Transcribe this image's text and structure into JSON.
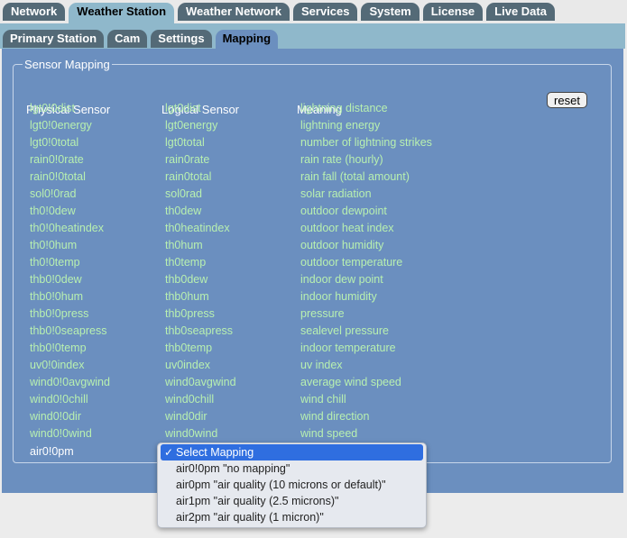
{
  "main_tabs": [
    "Network",
    "Weather Station",
    "Weather Network",
    "Services",
    "System",
    "License",
    "Live Data"
  ],
  "main_active": "Weather Station",
  "sub_tabs": [
    "Primary Station",
    "Cam",
    "Settings",
    "Mapping"
  ],
  "sub_active": "Mapping",
  "section": {
    "legend": "Sensor Mapping",
    "col_physical": "Physical Sensor",
    "col_logical": "Logical Sensor",
    "col_meaning": "Meaning",
    "reset_label": "reset"
  },
  "rows": [
    {
      "physical": "lgt0!0dist",
      "logical": "lgt0dist",
      "meaning": "lightning distance"
    },
    {
      "physical": "lgt0!0energy",
      "logical": "lgt0energy",
      "meaning": "lightning energy"
    },
    {
      "physical": "lgt0!0total",
      "logical": "lgt0total",
      "meaning": "number of lightning strikes"
    },
    {
      "physical": "rain0!0rate",
      "logical": "rain0rate",
      "meaning": "rain rate (hourly)"
    },
    {
      "physical": "rain0!0total",
      "logical": "rain0total",
      "meaning": "rain fall (total amount)"
    },
    {
      "physical": "sol0!0rad",
      "logical": "sol0rad",
      "meaning": "solar radiation"
    },
    {
      "physical": "th0!0dew",
      "logical": "th0dew",
      "meaning": "outdoor dewpoint"
    },
    {
      "physical": "th0!0heatindex",
      "logical": "th0heatindex",
      "meaning": "outdoor heat index"
    },
    {
      "physical": "th0!0hum",
      "logical": "th0hum",
      "meaning": "outdoor humidity"
    },
    {
      "physical": "th0!0temp",
      "logical": "th0temp",
      "meaning": "outdoor temperature"
    },
    {
      "physical": "thb0!0dew",
      "logical": "thb0dew",
      "meaning": "indoor dew point"
    },
    {
      "physical": "thb0!0hum",
      "logical": "thb0hum",
      "meaning": "indoor humidity"
    },
    {
      "physical": "thb0!0press",
      "logical": "thb0press",
      "meaning": "pressure"
    },
    {
      "physical": "thb0!0seapress",
      "logical": "thb0seapress",
      "meaning": "sealevel pressure"
    },
    {
      "physical": "thb0!0temp",
      "logical": "thb0temp",
      "meaning": "indoor temperature"
    },
    {
      "physical": "uv0!0index",
      "logical": "uv0index",
      "meaning": "uv index"
    },
    {
      "physical": "wind0!0avgwind",
      "logical": "wind0avgwind",
      "meaning": "average wind speed"
    },
    {
      "physical": "wind0!0chill",
      "logical": "wind0chill",
      "meaning": "wind chill"
    },
    {
      "physical": "wind0!0dir",
      "logical": "wind0dir",
      "meaning": "wind direction"
    },
    {
      "physical": "wind0!0wind",
      "logical": "wind0wind",
      "meaning": "wind speed"
    }
  ],
  "unmapped_physical": "air0!0pm",
  "dropdown": {
    "selected": "Select Mapping",
    "options": [
      "air0!0pm \"no mapping\"",
      "air0pm \"air quality (10 microns or default)\"",
      "air1pm \"air quality (2.5 microns)\"",
      "air2pm \"air quality (1 micron)\""
    ]
  }
}
